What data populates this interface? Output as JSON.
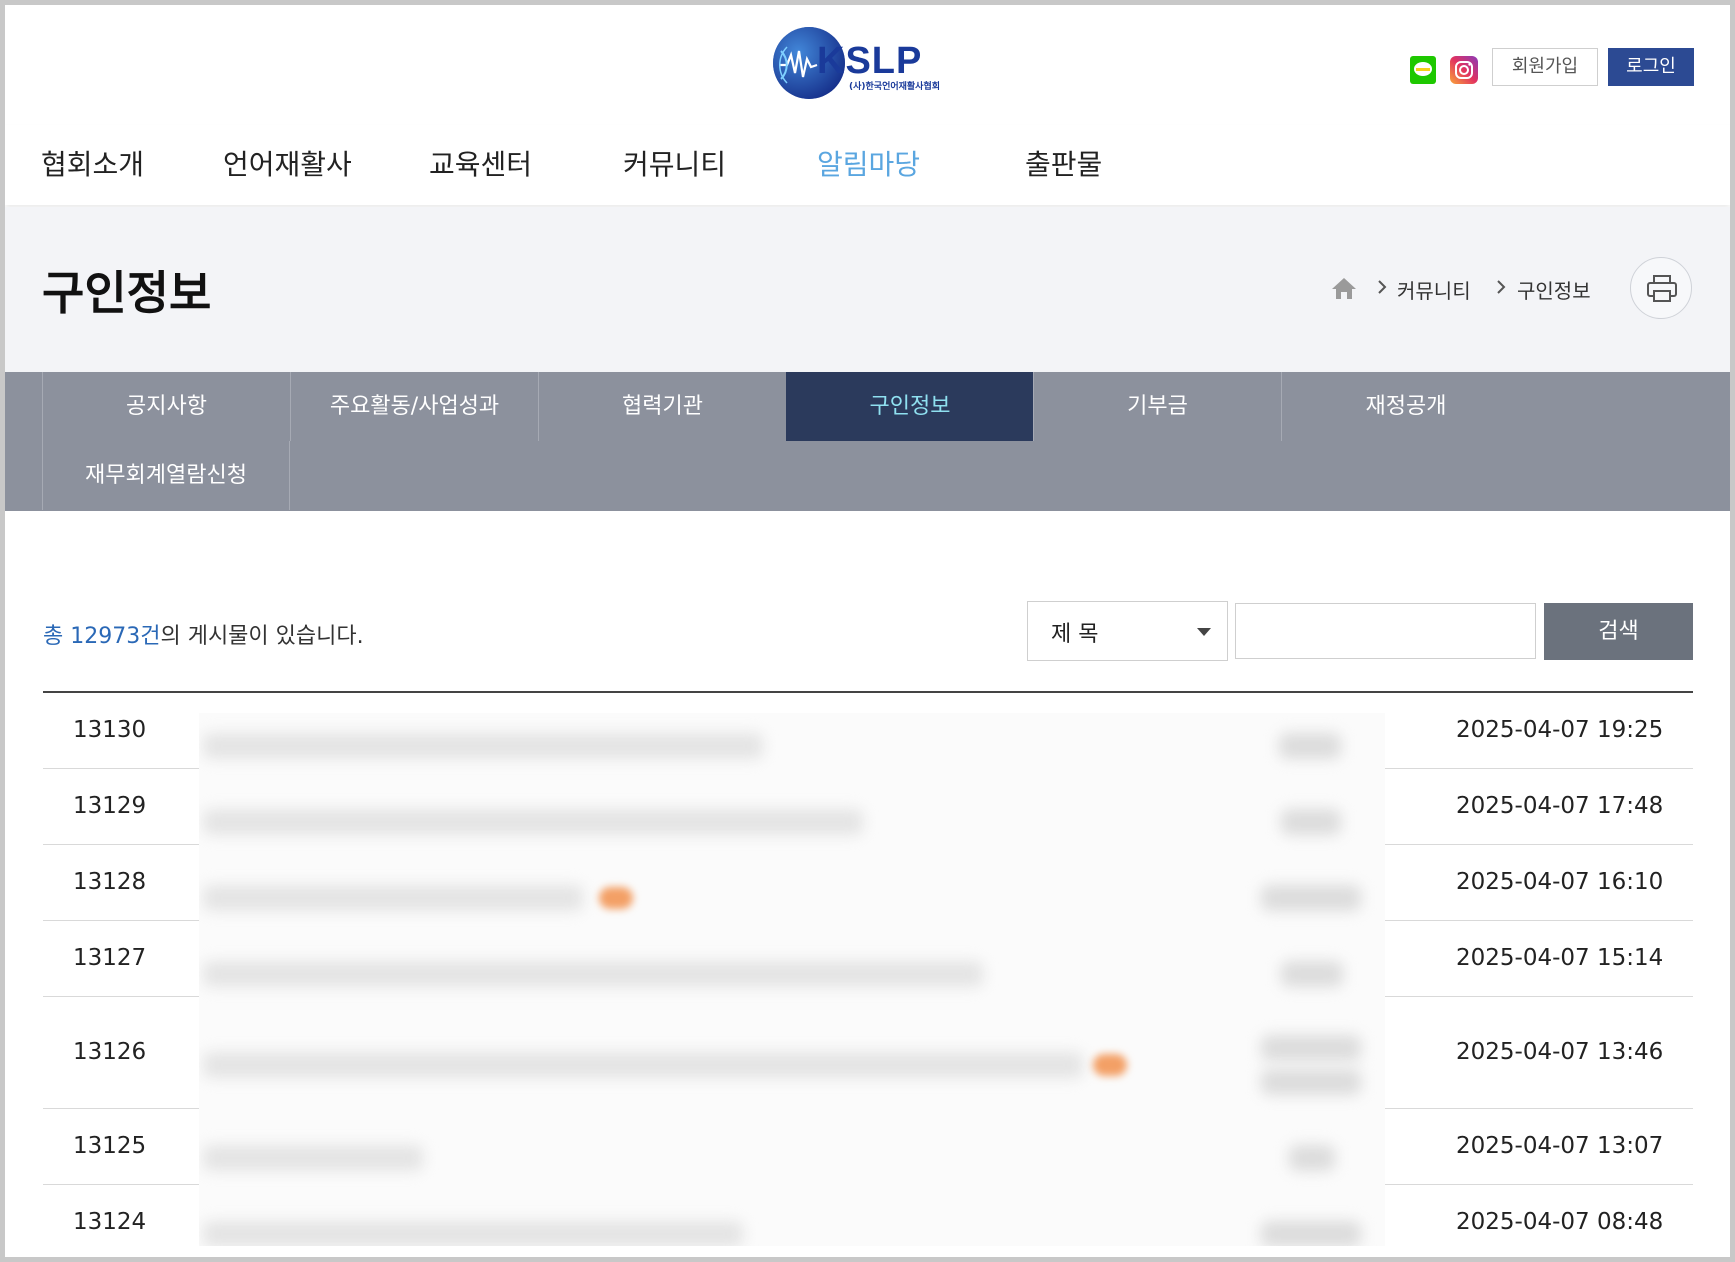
{
  "header": {
    "logo_text": "KSLP",
    "logo_subtext": "(사)한국언어재활사협회",
    "join_label": "회원가입",
    "login_label": "로그인"
  },
  "gnb": {
    "items": [
      {
        "label": "협회소개",
        "active": false
      },
      {
        "label": "언어재활사",
        "active": false
      },
      {
        "label": "교육센터",
        "active": false
      },
      {
        "label": "커뮤니티",
        "active": false
      },
      {
        "label": "알림마당",
        "active": true
      },
      {
        "label": "출판물",
        "active": false
      }
    ]
  },
  "page": {
    "title": "구인정보",
    "breadcrumb": [
      "커뮤니티",
      "구인정보"
    ]
  },
  "subtabs": [
    {
      "label": "공지사항",
      "active": false
    },
    {
      "label": "주요활동/사업성과",
      "active": false
    },
    {
      "label": "협력기관",
      "active": false
    },
    {
      "label": "구인정보",
      "active": true
    },
    {
      "label": "기부금",
      "active": false
    },
    {
      "label": "재정공개",
      "active": false
    },
    {
      "label": "재무회계열람신청",
      "active": false
    }
  ],
  "list": {
    "total_prefix": "총 ",
    "total_count": "12973건",
    "total_suffix": "의 게시물이 있습니다.",
    "search_field": "제 목",
    "search_value": "",
    "search_button": "검색",
    "rows": [
      {
        "num": "13130",
        "date": "2025-04-07 19:25"
      },
      {
        "num": "13129",
        "date": "2025-04-07 17:48"
      },
      {
        "num": "13128",
        "date": "2025-04-07 16:10"
      },
      {
        "num": "13127",
        "date": "2025-04-07 15:14"
      },
      {
        "num": "13126",
        "date": "2025-04-07 13:46"
      },
      {
        "num": "13125",
        "date": "2025-04-07 13:07"
      },
      {
        "num": "13124",
        "date": "2025-04-07 08:48"
      }
    ]
  },
  "colors": {
    "brand_blue": "#2c4a93",
    "gnb_active": "#5aa6e0",
    "subtab_bg": "#8c919d",
    "subtab_active_bg": "#2b3a5c",
    "subtab_active_text": "#8fe0f0",
    "count_accent": "#2a68b6"
  }
}
